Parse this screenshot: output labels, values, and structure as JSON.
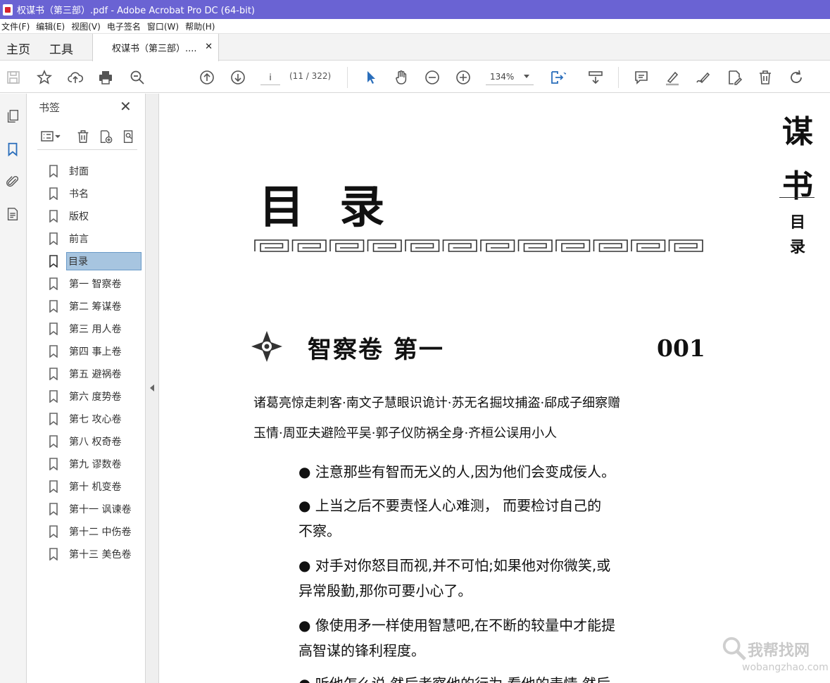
{
  "window": {
    "title": "权谋书（第三部）.pdf - Adobe Acrobat Pro DC (64-bit)"
  },
  "menu": [
    "文件(F)",
    "编辑(E)",
    "视图(V)",
    "电子签名",
    "窗口(W)",
    "帮助(H)"
  ],
  "tabs": {
    "home": "主页",
    "tools": "工具",
    "document": "权谋书（第三部）...."
  },
  "toolbar": {
    "page_value": "i",
    "page_count": "(11 / 322)",
    "zoom": "134%"
  },
  "bookmarks": {
    "title": "书签",
    "items": [
      "封面",
      "书名",
      "版权",
      "前言",
      "目录",
      "第一  智察卷",
      "第二  筹谋卷",
      "第三  用人卷",
      "第四  事上卷",
      "第五  避祸卷",
      "第六  度势卷",
      "第七  攻心卷",
      "第八  权奇卷",
      "第九  谬数卷",
      "第十  机变卷",
      "第十一  讽谏卷",
      "第十二  中伤卷",
      "第十三  美色卷"
    ],
    "selected_index": 4
  },
  "page": {
    "title": "目 录",
    "chapter": "智察卷  第一",
    "chapter_number": "001",
    "subtitle_line1": "诸葛亮惊走刺客·南文子慧眼识诡计·苏无名掘坟捕盗·郈成子细察赠",
    "subtitle_line2": "玉情·周亚夫避险平吴·郭子仪防祸全身·齐桓公误用小人",
    "bullets": [
      "● 注意那些有智而无义的人,因为他们会变成佞人。",
      "● 上当之后不要责怪人心难测， 而要检讨自己的",
      "不察。",
      "● 对手对你怒目而视,并不可怕;如果他对你微笑,或",
      "异常殷勤,那你可要小心了。",
      "● 像使用矛一样使用智慧吧,在不断的较量中才能提",
      "高智谋的锋利程度。",
      "● 听他怎么说,然后考察他的行为,看他的表情,然后"
    ],
    "side_title_chars": [
      "谋",
      "书"
    ],
    "side_sub_chars": [
      "目",
      "录"
    ]
  },
  "watermark": {
    "text": "我帮找网",
    "sub": "wobangzhao.com"
  }
}
